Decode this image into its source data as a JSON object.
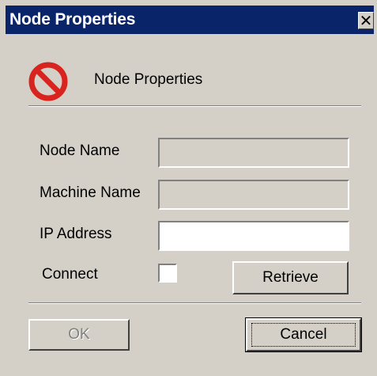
{
  "window": {
    "title": "Node Properties",
    "close_glyph": "✕"
  },
  "header": {
    "icon": "no-entry-icon",
    "label": "Node Properties"
  },
  "fields": {
    "node_name": {
      "label": "Node Name",
      "value": ""
    },
    "machine_name": {
      "label": "Machine Name",
      "value": ""
    },
    "ip_address": {
      "label": "IP Address",
      "value": ""
    },
    "connect": {
      "label": "Connect",
      "checked": false
    }
  },
  "buttons": {
    "retrieve": "Retrieve",
    "ok": "OK",
    "cancel": "Cancel"
  },
  "colors": {
    "titlebar": "#0a246a",
    "face": "#d4d0c8",
    "icon_red": "#d8231f"
  }
}
